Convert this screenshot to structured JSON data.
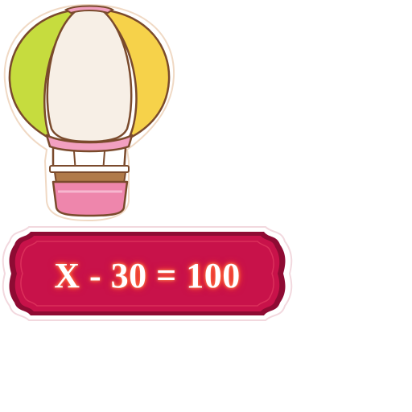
{
  "equation": {
    "text": "X - 30 = 100"
  },
  "icons": {
    "balloon": "hot-air-balloon-icon",
    "banner": "ribbon-banner"
  },
  "colors": {
    "balloon_green": "#c6dc3e",
    "balloon_cream": "#f7efe6",
    "balloon_yellow": "#f6d24a",
    "balloon_pink": "#f2a0c0",
    "basket_pink": "#ee86ac",
    "basket_inner": "#b07a4a",
    "outline": "#7a4a2c",
    "banner_red": "#c8124a",
    "banner_border": "#8e0b33",
    "banner_glow": "#ff6a3a"
  }
}
